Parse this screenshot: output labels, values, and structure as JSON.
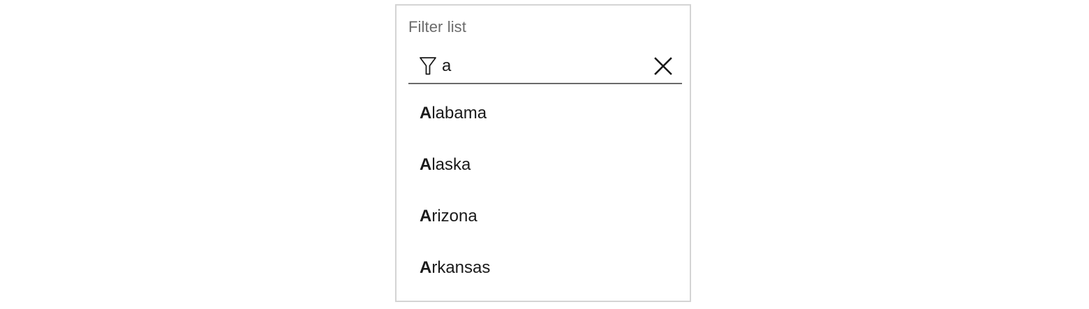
{
  "filter_panel": {
    "title": "Filter list",
    "search": {
      "value": "a",
      "placeholder": "",
      "icon": "filter-icon",
      "clear_icon": "close-icon"
    },
    "results": [
      {
        "match": "A",
        "rest": "labama"
      },
      {
        "match": "A",
        "rest": "laska"
      },
      {
        "match": "A",
        "rest": "rizona"
      },
      {
        "match": "A",
        "rest": "rkansas"
      }
    ]
  },
  "colors": {
    "panel_border": "#d4d4d4",
    "title_text": "#6b6b6b",
    "underline": "#6a6a6a",
    "text": "#1a1a1a"
  }
}
